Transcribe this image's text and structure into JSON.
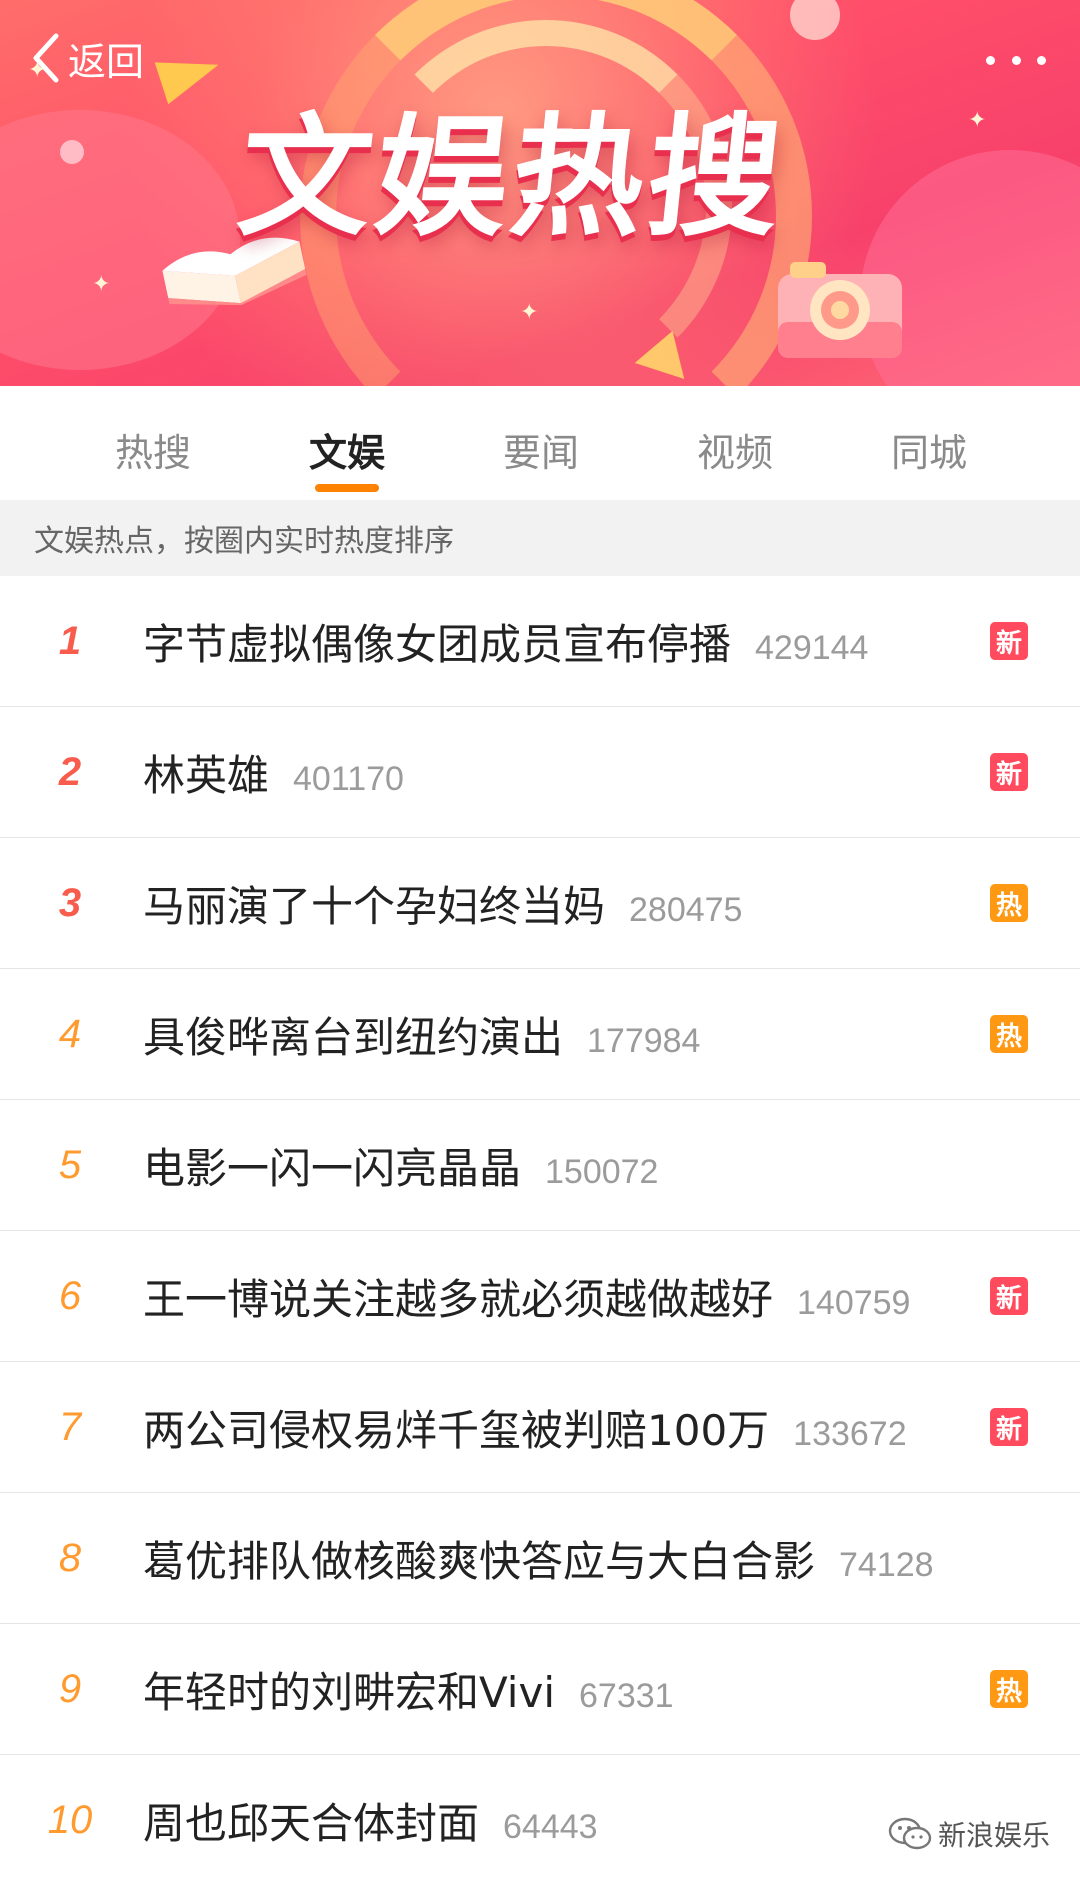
{
  "banner": {
    "back_label": "返回",
    "title": "文娱热搜"
  },
  "tabs": [
    {
      "label": "热搜",
      "active": false
    },
    {
      "label": "文娱",
      "active": true
    },
    {
      "label": "要闻",
      "active": false
    },
    {
      "label": "视频",
      "active": false
    },
    {
      "label": "同城",
      "active": false
    }
  ],
  "subheader": "文娱热点，按圈内实时热度排序",
  "items": [
    {
      "rank": "1",
      "title": "字节虚拟偶像女团成员宣布停播",
      "count": "429144",
      "badge": "新"
    },
    {
      "rank": "2",
      "title": "林英雄",
      "count": "401170",
      "badge": "新"
    },
    {
      "rank": "3",
      "title": "马丽演了十个孕妇终当妈",
      "count": "280475",
      "badge": "热"
    },
    {
      "rank": "4",
      "title": "具俊晔离台到纽约演出",
      "count": "177984",
      "badge": "热"
    },
    {
      "rank": "5",
      "title": "电影一闪一闪亮晶晶",
      "count": "150072",
      "badge": ""
    },
    {
      "rank": "6",
      "title": "王一博说关注越多就必须越做越好",
      "count": "140759",
      "badge": "新"
    },
    {
      "rank": "7",
      "title": "两公司侵权易烊千玺被判赔100万",
      "count": "133672",
      "badge": "新"
    },
    {
      "rank": "8",
      "title": "葛优排队做核酸爽快答应与大白合影",
      "count": "74128",
      "badge": ""
    },
    {
      "rank": "9",
      "title": "年轻时的刘畊宏和Vivi",
      "count": "67331",
      "badge": "热"
    },
    {
      "rank": "10",
      "title": "周也邱天合体封面",
      "count": "64443",
      "badge": ""
    }
  ],
  "watermark": "新浪娱乐",
  "colors": {
    "accent": "#ff8200",
    "badge_new": "#ff4b5d",
    "badge_hot": "#ff9812",
    "rank_top": "#f75c4c",
    "rank_other": "#ff9a2e"
  }
}
